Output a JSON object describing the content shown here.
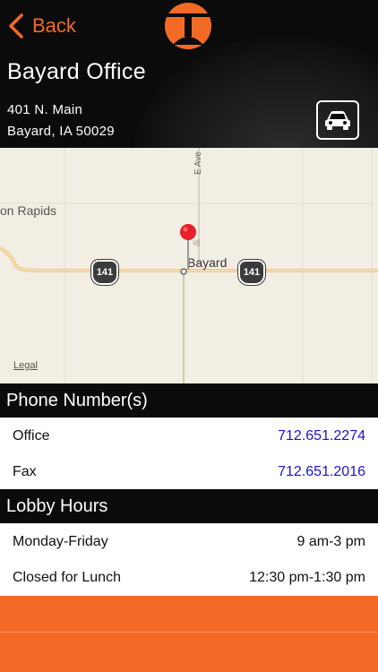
{
  "nav": {
    "back_label": "Back"
  },
  "office": {
    "name": "Bayard Office",
    "address_line1": "401 N. Main",
    "address_line2": "Bayard, IA  50029"
  },
  "map": {
    "place_left": "on Rapids",
    "town": "Bayard",
    "street": "E Ave",
    "highway_left": "141",
    "highway_right": "141",
    "legal": "Legal"
  },
  "phones": {
    "header": "Phone Number(s)",
    "items": [
      {
        "label": "Office",
        "value": "712.651.2274"
      },
      {
        "label": "Fax",
        "value": "712.651.2016"
      }
    ]
  },
  "hours": {
    "header": "Lobby Hours",
    "items": [
      {
        "label": "Monday-Friday",
        "value": "9 am-3 pm"
      },
      {
        "label": "Closed for Lunch",
        "value": "12:30 pm-1:30 pm"
      }
    ]
  },
  "colors": {
    "accent": "#f26a25",
    "link": "#1a14c9",
    "header_bg": "#0b0b0b"
  }
}
